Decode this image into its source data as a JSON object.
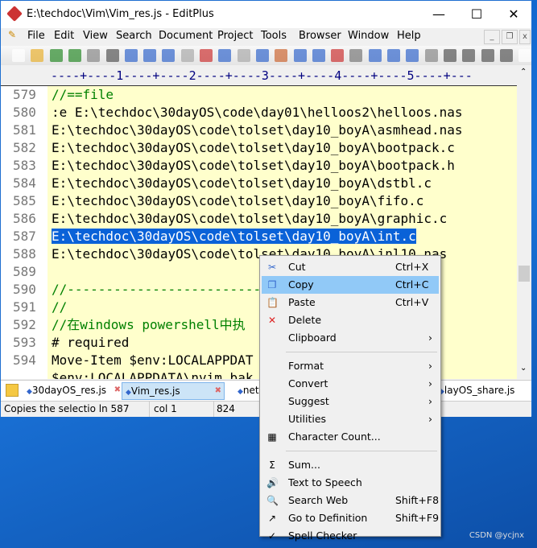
{
  "title": "E:\\techdoc\\Vim\\Vim_res.js - EditPlus",
  "window_controls": {
    "minimize": "—",
    "maximize": "☐",
    "close": "✕"
  },
  "menu": [
    "File",
    "Edit",
    "View",
    "Search",
    "Document",
    "Project",
    "Tools",
    "Browser",
    "Window",
    "Help"
  ],
  "ruler": "----+----1----+----2----+----3----+----4----+----5----+---",
  "lines": [
    {
      "n": "579",
      "text": "//==file",
      "type": "comment"
    },
    {
      "n": "580",
      "text": ":e E:\\techdoc\\30dayOS\\code\\day01\\helloos2\\helloos.nas",
      "type": "code"
    },
    {
      "n": "581",
      "text": "E:\\techdoc\\30dayOS\\code\\tolset\\day10_boyA\\asmhead.nas",
      "type": "code"
    },
    {
      "n": "582",
      "text": "E:\\techdoc\\30dayOS\\code\\tolset\\day10_boyA\\bootpack.c",
      "type": "code"
    },
    {
      "n": "583",
      "text": "E:\\techdoc\\30dayOS\\code\\tolset\\day10_boyA\\bootpack.h",
      "type": "code"
    },
    {
      "n": "584",
      "text": "E:\\techdoc\\30dayOS\\code\\tolset\\day10_boyA\\dstbl.c",
      "type": "code"
    },
    {
      "n": "585",
      "text": "E:\\techdoc\\30dayOS\\code\\tolset\\day10_boyA\\fifo.c",
      "type": "code"
    },
    {
      "n": "586",
      "text": "E:\\techdoc\\30dayOS\\code\\tolset\\day10_boyA\\graphic.c",
      "type": "code"
    },
    {
      "n": "587",
      "text": "E:\\techdoc\\30dayOS\\code\\tolset\\day10_boyA\\int.c",
      "type": "selected"
    },
    {
      "n": "588",
      "text": "E:\\techdoc\\30dayOS\\code\\tolset\\day10_boyA\\inl10.nas",
      "type": "code"
    },
    {
      "n": "589",
      "text": "",
      "type": "code"
    },
    {
      "n": "590",
      "text": "//-------------------------",
      "type": "comment"
    },
    {
      "n": "591",
      "text": "//",
      "type": "comment"
    },
    {
      "n": "592",
      "text": "//在windows powershell中执",
      "type": "comment"
    },
    {
      "n": "593",
      "text": "# required",
      "type": "code"
    },
    {
      "n": "594",
      "text": "Move-Item $env:LOCALAPPDAT",
      "type": "code"
    },
    {
      "n": "",
      "text": "$env:LOCALAPPDATA\\nvim.bak",
      "type": "code"
    }
  ],
  "tabs": [
    {
      "label": "30dayOS_res.js",
      "active": false
    },
    {
      "label": "Vim_res.js",
      "active": true
    },
    {
      "label": "net",
      "active": false
    },
    {
      "label": "layOS_share.js",
      "active": false
    }
  ],
  "status": {
    "message": "Copies the selectio",
    "line": "ln 587",
    "col": "col 1",
    "chars": "824"
  },
  "context_menu": {
    "items": [
      {
        "label": "Cut",
        "shortcut": "Ctrl+X",
        "icon": "scissors-icon",
        "glyph": "✂"
      },
      {
        "label": "Copy",
        "shortcut": "Ctrl+C",
        "icon": "copy-icon",
        "glyph": "❐",
        "highlighted": true
      },
      {
        "label": "Paste",
        "shortcut": "Ctrl+V",
        "icon": "paste-icon",
        "glyph": "📋"
      },
      {
        "label": "Delete",
        "icon": "delete-icon",
        "glyph": "✕"
      },
      {
        "label": "Clipboard",
        "submenu": true
      },
      {
        "separator": true
      },
      {
        "label": "Format",
        "submenu": true
      },
      {
        "label": "Convert",
        "submenu": true
      },
      {
        "label": "Suggest",
        "submenu": true
      },
      {
        "label": "Utilities",
        "submenu": true
      },
      {
        "label": "Character Count...",
        "icon": "calculator-icon",
        "glyph": "▦"
      },
      {
        "separator": true
      },
      {
        "label": "Sum...",
        "icon": "sigma-icon",
        "glyph": "Σ"
      },
      {
        "label": "Text to Speech",
        "icon": "speaker-icon",
        "glyph": "🔊"
      },
      {
        "label": "Search Web",
        "shortcut": "Shift+F8",
        "icon": "globe-search-icon",
        "glyph": "🔍"
      },
      {
        "label": "Go to Definition",
        "shortcut": "Shift+F9",
        "icon": "definition-icon",
        "glyph": "↗"
      },
      {
        "label": "Spell Checker",
        "icon": "spell-check-icon",
        "glyph": "✓"
      }
    ]
  },
  "watermark": "CSDN @ycjnx",
  "colors": {
    "editor_bg": "#ffffcc",
    "selection": "#0a62d8",
    "comment": "#008000",
    "menu_highlight": "#91c9f7"
  }
}
